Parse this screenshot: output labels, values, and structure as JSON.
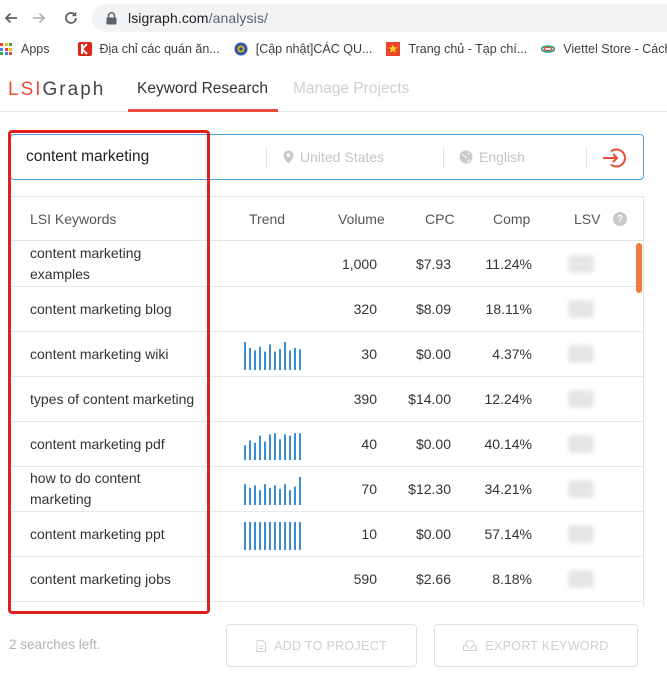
{
  "browser": {
    "url_host": "lsigraph.com",
    "url_path": "/analysis/",
    "bookmarks": [
      {
        "label": "Apps",
        "icon": "apps-grid-icon"
      },
      {
        "label": "Địa chỉ các quán ăn...",
        "icon": "k-logo-icon",
        "color": "#d8281e"
      },
      {
        "label": "[Cập nhật]CÁC QU...",
        "icon": "circle-logo-icon",
        "color": "#2b5aa8"
      },
      {
        "label": "Trang chủ - Tạp chí...",
        "icon": "flag-logo-icon",
        "color": "#e8472b"
      },
      {
        "label": "Viettel Store - Cách...",
        "icon": "viettel-logo-icon",
        "color": "#1fa67a"
      }
    ]
  },
  "app": {
    "logo_lsi": "LSI",
    "logo_graph": "Graph",
    "tabs": [
      {
        "label": "Keyword Research",
        "active": true
      },
      {
        "label": "Manage Projects",
        "active": false
      }
    ],
    "accent_color": "#e84d3d"
  },
  "search": {
    "keyword": "content marketing",
    "location_placeholder": "United States",
    "language_placeholder": "English"
  },
  "table": {
    "headers": {
      "keyword": "LSI Keywords",
      "trend": "Trend",
      "volume": "Volume",
      "cpc": "CPC",
      "comp": "Comp",
      "lsv": "LSV"
    },
    "rows": [
      {
        "keyword": "content marketing examples",
        "volume": "1,000",
        "cpc": "$7.93",
        "comp": "11.24%",
        "trend": []
      },
      {
        "keyword": "content marketing blog",
        "volume": "320",
        "cpc": "$8.09",
        "comp": "18.11%",
        "trend": []
      },
      {
        "keyword": "content marketing wiki",
        "volume": "30",
        "cpc": "$0.00",
        "comp": "4.37%",
        "trend": [
          1,
          0.75,
          0.65,
          0.8,
          0.6,
          0.9,
          0.6,
          0.7,
          1,
          0.65,
          0.75,
          0.7
        ]
      },
      {
        "keyword": "types of content marketing",
        "volume": "390",
        "cpc": "$14.00",
        "comp": "12.24%",
        "trend": []
      },
      {
        "keyword": "content marketing pdf",
        "volume": "40",
        "cpc": "$0.00",
        "comp": "40.14%",
        "trend": [
          0.45,
          0.65,
          0.55,
          0.85,
          0.6,
          0.9,
          0.95,
          0.7,
          0.9,
          0.85,
          0.95,
          0.95
        ]
      },
      {
        "keyword": "how to do content marketing",
        "volume": "70",
        "cpc": "$12.30",
        "comp": "34.21%",
        "trend": [
          0.7,
          0.55,
          0.65,
          0.45,
          0.7,
          0.55,
          0.65,
          0.5,
          0.7,
          0.45,
          0.6,
          1
        ]
      },
      {
        "keyword": "content marketing ppt",
        "volume": "10",
        "cpc": "$0.00",
        "comp": "57.14%",
        "trend": [
          1,
          1,
          1,
          1,
          1,
          1,
          1,
          1,
          1,
          1,
          1,
          1
        ]
      },
      {
        "keyword": "content marketing jobs",
        "volume": "590",
        "cpc": "$2.66",
        "comp": "8.18%",
        "trend": []
      }
    ],
    "trend_color": "#3a8ed4"
  },
  "footer": {
    "searches_left": "2 searches left.",
    "add_to_project": "ADD TO PROJECT",
    "export_keyword": "EXPORT KEYWORD"
  },
  "highlight_color": "#e02020"
}
